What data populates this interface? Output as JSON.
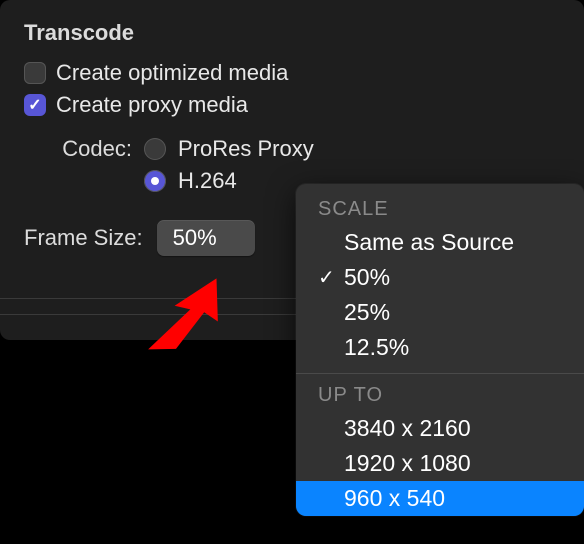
{
  "section_title": "Transcode",
  "checkbox_optimized": "Create optimized media",
  "checkbox_proxy": "Create proxy media",
  "codec_label": "Codec:",
  "codec_options": {
    "prores": "ProRes Proxy",
    "h264": "H.264"
  },
  "frame_size_label": "Frame Size:",
  "frame_size_value": "50%",
  "menu": {
    "header_scale": "SCALE",
    "items_scale": [
      {
        "label": "Same as Source",
        "checked": false
      },
      {
        "label": "50%",
        "checked": true
      },
      {
        "label": "25%",
        "checked": false
      },
      {
        "label": "12.5%",
        "checked": false
      }
    ],
    "header_upto": "UP TO",
    "items_upto": [
      {
        "label": "3840 x 2160",
        "highlight": false
      },
      {
        "label": "1920 x 1080",
        "highlight": false
      },
      {
        "label": "960 x 540",
        "highlight": true
      }
    ]
  }
}
